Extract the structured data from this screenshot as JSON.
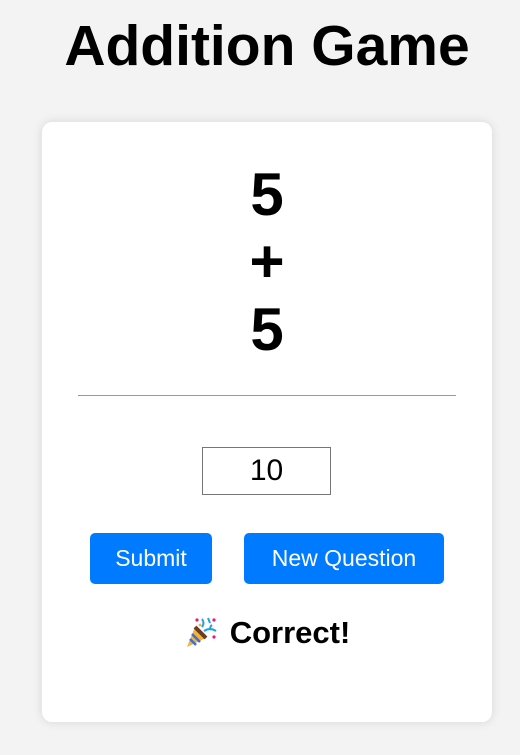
{
  "title": "Addition Game",
  "question": {
    "operand1": "5",
    "operator": "+",
    "operand2": "5"
  },
  "answer_input": {
    "value": "10"
  },
  "buttons": {
    "submit": "Submit",
    "new_question": "New Question"
  },
  "result": {
    "icon": "party-popper-icon",
    "text": "Correct!"
  },
  "colors": {
    "accent": "#007bff",
    "background": "#f3f3f3"
  }
}
